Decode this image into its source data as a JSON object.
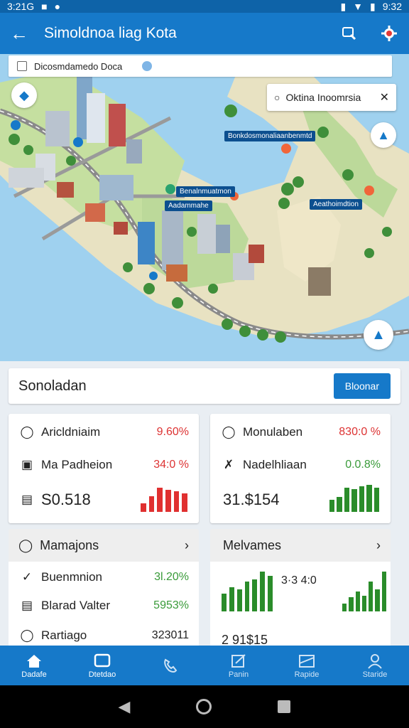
{
  "status_bar": {
    "time_left": "3:21G",
    "time_right": "9:32"
  },
  "app": {
    "title": "Simoldnoa liag Kota",
    "back_icon": "arrow-left-icon",
    "actions": [
      "map-search-icon",
      "gear-icon"
    ]
  },
  "map": {
    "search_text": "Dicosmdamedo Doca",
    "location_card": {
      "text": "Oktina Inoomrsia"
    },
    "tags": [
      "Bonkdosmonaliaanbenmtd",
      "Benalnmuatmon",
      "Aadammahe",
      "Aeathoimdtion"
    ]
  },
  "summary": {
    "label": "Sonoladan",
    "button": "Bloonar"
  },
  "card_left": {
    "rows": [
      {
        "label": "Aricldniaim",
        "value": "9.60%"
      },
      {
        "label": "Ma Padheion",
        "value": "34:0 %"
      }
    ],
    "total": "S0.518",
    "bar_color": "#e03030",
    "bars": [
      0.35,
      0.65,
      1.0,
      0.9,
      0.85,
      0.75
    ]
  },
  "card_right": {
    "rows": [
      {
        "label": "Monulaben",
        "value": "830:0 %"
      },
      {
        "label": "Nadelhliaan",
        "value": "0.0.8%"
      }
    ],
    "total": "31.$154",
    "bar_color": "#2a8c2a",
    "bars": [
      0.45,
      0.55,
      0.9,
      0.85,
      0.95,
      1.0,
      0.9
    ]
  },
  "section_left": {
    "title": "Mamajons",
    "rows": [
      {
        "label": "Buenmnion",
        "value": "3l.20%"
      },
      {
        "label": "Blarad Valter",
        "value": "5953%"
      },
      {
        "label": "Rartiago",
        "value": "323011"
      }
    ]
  },
  "section_right": {
    "title": "Melvames",
    "chart1_label": "3·3 4:0",
    "chart2_label": "2 91$15",
    "bars_a": [
      0.45,
      0.6,
      0.55,
      0.75,
      0.8,
      1.0,
      0.9
    ],
    "bars_b": [
      0.2,
      0.35,
      0.5,
      0.4,
      0.75,
      0.55,
      1.0
    ]
  },
  "bottom_nav": [
    {
      "label": "Dadafe",
      "icon": "home-icon"
    },
    {
      "label": "Dtetdao",
      "icon": "dashboard-icon"
    },
    {
      "label": "",
      "icon": "phone-icon"
    },
    {
      "label": "Panin",
      "icon": "edit-icon"
    },
    {
      "label": "Rapide",
      "icon": "report-icon"
    },
    {
      "label": "Staride",
      "icon": "person-icon"
    }
  ]
}
